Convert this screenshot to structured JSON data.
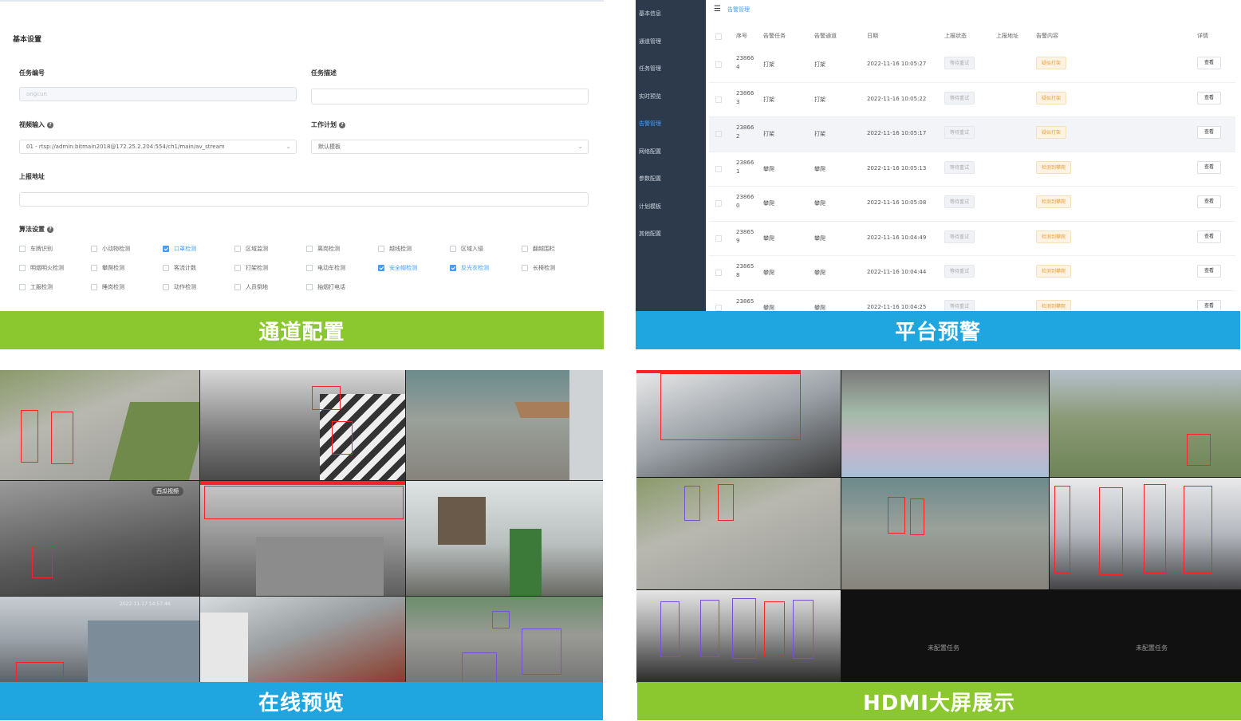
{
  "channel_config": {
    "section_title": "基本设置",
    "task_id_label": "任务编号",
    "task_id_value": "angcun",
    "task_desc_label": "任务描述",
    "video_input_label": "视频输入",
    "video_input_value": "01 - rtsp://admin:bitmain2018@172.25.2.204:554/ch1/main/av_stream",
    "work_plan_label": "工作计划",
    "work_plan_value": "默认模板",
    "report_url_label": "上报地址",
    "algo_label": "算法设置",
    "algorithms": [
      {
        "label": "车牌识别",
        "checked": false
      },
      {
        "label": "小动物检测",
        "checked": false
      },
      {
        "label": "口罩检测",
        "checked": true
      },
      {
        "label": "区域监测",
        "checked": false
      },
      {
        "label": "离岗检测",
        "checked": false
      },
      {
        "label": "越线检测",
        "checked": false
      },
      {
        "label": "区域入侵",
        "checked": false
      },
      {
        "label": "翻越围栏",
        "checked": false
      },
      {
        "label": "明烟明火检测",
        "checked": false
      },
      {
        "label": "攀爬检测",
        "checked": false
      },
      {
        "label": "客流计数",
        "checked": false
      },
      {
        "label": "打架检测",
        "checked": false
      },
      {
        "label": "电动车检测",
        "checked": false
      },
      {
        "label": "安全帽检测",
        "checked": true
      },
      {
        "label": "反光衣检测",
        "checked": true
      },
      {
        "label": "长椅检测",
        "checked": false
      },
      {
        "label": "工服检测",
        "checked": false
      },
      {
        "label": "睡岗检测",
        "checked": false
      },
      {
        "label": "动作检测",
        "checked": false
      },
      {
        "label": "人员倒地",
        "checked": false
      },
      {
        "label": "抽烟打电话",
        "checked": false
      }
    ]
  },
  "platform_alarm": {
    "menu": [
      {
        "label": "基本信息",
        "active": false
      },
      {
        "label": "通道管理",
        "active": false
      },
      {
        "label": "任务管理",
        "active": false
      },
      {
        "label": "实时预览",
        "active": false
      },
      {
        "label": "告警管理",
        "active": true
      },
      {
        "label": "网络配置",
        "active": false
      },
      {
        "label": "参数配置",
        "active": false
      },
      {
        "label": "计划模板",
        "active": false
      },
      {
        "label": "其他配置",
        "active": false
      }
    ],
    "breadcrumb": "告警管理",
    "columns": {
      "seq": "序号",
      "task": "告警任务",
      "channel": "告警通道",
      "date": "日期",
      "report_status": "上报状态",
      "report_url": "上报地址",
      "content": "告警内容",
      "detail": "详情"
    },
    "rows": [
      {
        "seq1": "23866",
        "seq2": "4",
        "task": "打架",
        "channel": "打架",
        "date": "2022-11-16 10:05:27",
        "status": "等待重试",
        "content": "疑似打架",
        "action": "查看"
      },
      {
        "seq1": "23866",
        "seq2": "3",
        "task": "打架",
        "channel": "打架",
        "date": "2022-11-16 10:05:22",
        "status": "等待重试",
        "content": "疑似打架",
        "action": "查看"
      },
      {
        "seq1": "23866",
        "seq2": "2",
        "task": "打架",
        "channel": "打架",
        "date": "2022-11-16 10:05:17",
        "status": "等待重试",
        "content": "疑似打架",
        "action": "查看"
      },
      {
        "seq1": "23866",
        "seq2": "1",
        "task": "攀爬",
        "channel": "攀爬",
        "date": "2022-11-16 10:05:13",
        "status": "等待重试",
        "content": "检测到攀爬",
        "action": "查看"
      },
      {
        "seq1": "23866",
        "seq2": "0",
        "task": "攀爬",
        "channel": "攀爬",
        "date": "2022-11-16 10:05:08",
        "status": "等待重试",
        "content": "检测到攀爬",
        "action": "查看"
      },
      {
        "seq1": "23865",
        "seq2": "9",
        "task": "攀爬",
        "channel": "攀爬",
        "date": "2022-11-16 10:04:49",
        "status": "等待重试",
        "content": "检测到攀爬",
        "action": "查看"
      },
      {
        "seq1": "23865",
        "seq2": "8",
        "task": "攀爬",
        "channel": "攀爬",
        "date": "2022-11-16 10:04:44",
        "status": "等待重试",
        "content": "检测到攀爬",
        "action": "查看"
      },
      {
        "seq1": "23865",
        "seq2": "",
        "task": "攀爬",
        "channel": "攀爬",
        "date": "2022-11-16 10:04:25",
        "status": "等待重试",
        "content": "检测到攀爬",
        "action": "查看"
      }
    ]
  },
  "online_preview": {
    "watermark": "西瓜视频",
    "osd_date": "2022-11-17 14:57:46"
  },
  "hdmi_wall": {
    "empty_label": "未配置任务"
  },
  "banners": {
    "channel_config": "通道配置",
    "platform_alarm": "平台预警",
    "online_preview": "在线预览",
    "hdmi_wall": "HDMI大屏展示"
  },
  "colors": {
    "green": "#8bc82f",
    "blue": "#1fa5e0",
    "sidebar": "#2d3a4b",
    "accent": "#409eff"
  }
}
